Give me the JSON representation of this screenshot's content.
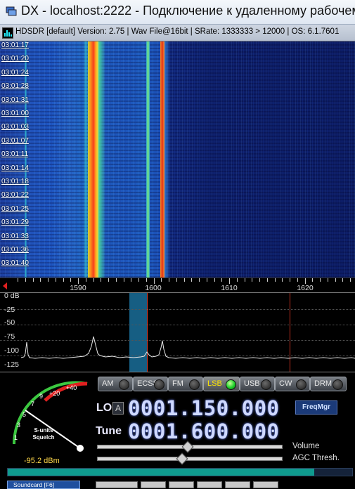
{
  "rdp_window": {
    "title": "DX - localhost:2222 - Подключение к удаленному рабочем",
    "icon": "remote-desktop-icon"
  },
  "app_window": {
    "title": "HDSDR  [default]  Version: 2.75   |  Wav File@16bit  |  SRate: 1333333 > 12000  |  OS: 6.1.7601",
    "icon": "hdsdr-icon"
  },
  "waterfall": {
    "timestamps": [
      "03:01:17",
      "03:01:20",
      "03:01:24",
      "03:01:28",
      "03:01:31",
      "03:01:00",
      "03:01:03",
      "03:01:07",
      "03:01:11",
      "03:01:14",
      "03:01:18",
      "03:01:22",
      "03:01:25",
      "03:01:29",
      "03:01:33",
      "03:01:36",
      "03:01:40"
    ]
  },
  "freq_scale": {
    "labels": [
      "1590",
      "1600",
      "1610",
      "1620"
    ]
  },
  "spectrum": {
    "db_labels": [
      "0 dB",
      "-25",
      "-50",
      "-75",
      "-100",
      "-125"
    ]
  },
  "smeter": {
    "scale_labels": [
      "1",
      "3",
      "5",
      "7",
      "9",
      "+20",
      "+40"
    ],
    "title_line1": "S-units",
    "title_line2": "Squelch",
    "dbm_reading": "-95.2 dBm",
    "level_percent": 89
  },
  "modes": [
    {
      "label": "AM",
      "active": false
    },
    {
      "label": "ECSS",
      "active": false
    },
    {
      "label": "FM",
      "active": false
    },
    {
      "label": "LSB",
      "active": true
    },
    {
      "label": "USB",
      "active": false
    },
    {
      "label": "CW",
      "active": false
    },
    {
      "label": "DRM",
      "active": false
    }
  ],
  "lo": {
    "label": "LO",
    "button": "A",
    "value": "0001.150.000"
  },
  "freqmgr_label": "FreqMgr",
  "tune": {
    "label": "Tune",
    "value": "0001.600.000"
  },
  "sliders": {
    "volume_label": "Volume",
    "volume_level": 0.48,
    "agc_label": "AGC Thresh.",
    "agc_level": 0.45
  },
  "bottom_bar": {
    "soundcard_label": "Soundcard  [F6]"
  },
  "colors": {
    "accent_blue": "#1b3a78",
    "lsb_active": "#ffe600",
    "led_on": "#1ccf2a",
    "level_fill": "#0f9b8e",
    "dbm_text": "#ffd84a"
  }
}
